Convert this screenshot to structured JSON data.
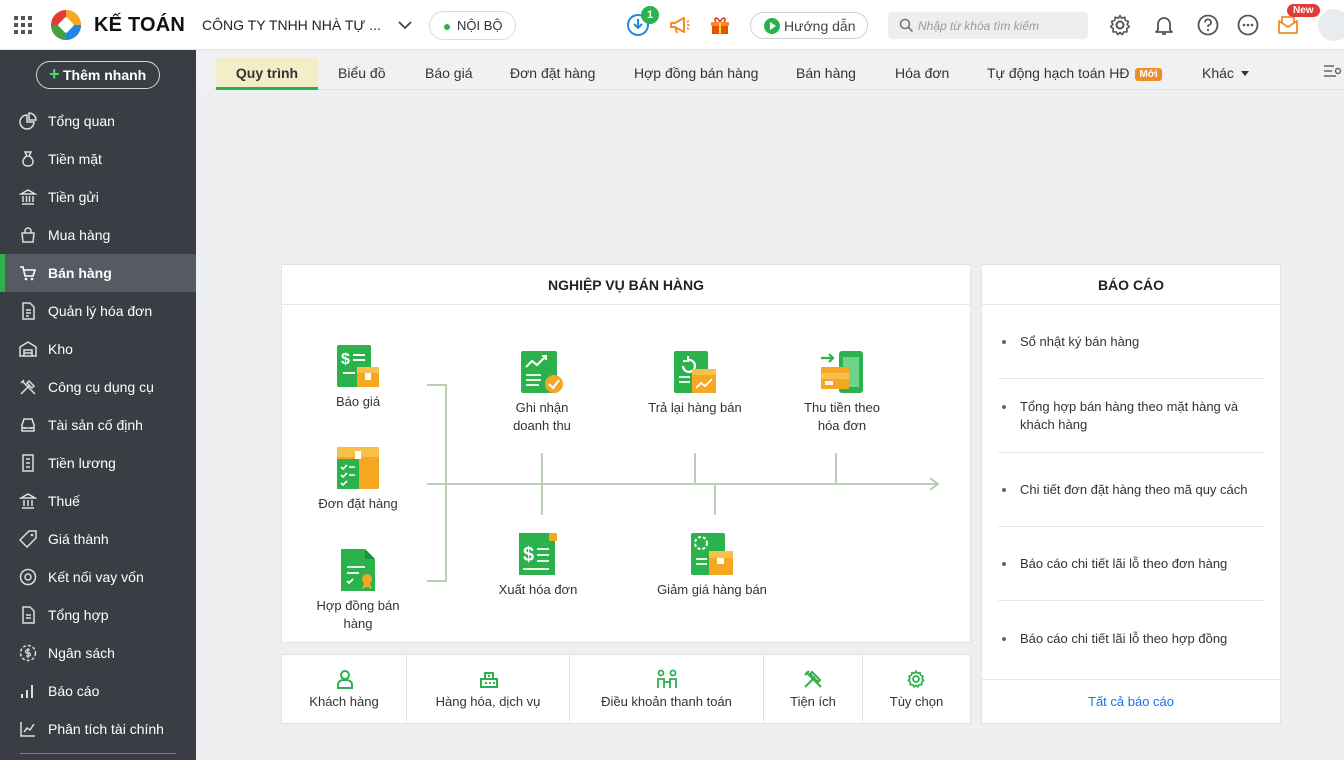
{
  "header": {
    "brand": "KẾ TOÁN",
    "company": "CÔNG TY TNHH NHÀ TỰ ...",
    "scope": "NỘI BỘ",
    "download_badge": "1",
    "guide_label": "Hướng dẫn",
    "search_placeholder": "Nhập từ khóa tìm kiếm",
    "new_badge": "New"
  },
  "sidebar": {
    "quick_add": "Thêm nhanh",
    "items": [
      {
        "label": "Tổng quan",
        "icon": "pie-chart-icon"
      },
      {
        "label": "Tiền mặt",
        "icon": "money-bag-icon"
      },
      {
        "label": "Tiền gửi",
        "icon": "bank-icon"
      },
      {
        "label": "Mua hàng",
        "icon": "shopping-bag-icon"
      },
      {
        "label": "Bán hàng",
        "icon": "cart-icon",
        "active": true
      },
      {
        "label": "Quản lý hóa đơn",
        "icon": "invoice-icon"
      },
      {
        "label": "Kho",
        "icon": "warehouse-icon"
      },
      {
        "label": "Công cụ dụng cụ",
        "icon": "tools-icon"
      },
      {
        "label": "Tài sản cố định",
        "icon": "car-icon"
      },
      {
        "label": "Tiền lương",
        "icon": "payroll-icon"
      },
      {
        "label": "Thuế",
        "icon": "tax-icon"
      },
      {
        "label": "Giá thành",
        "icon": "tag-icon"
      },
      {
        "label": "Kết nối vay vốn",
        "icon": "loan-icon"
      },
      {
        "label": "Tổng hợp",
        "icon": "summary-icon"
      },
      {
        "label": "Ngân sách",
        "icon": "budget-icon"
      },
      {
        "label": "Báo cáo",
        "icon": "bar-chart-icon"
      },
      {
        "label": "Phân tích tài chính",
        "icon": "analysis-icon"
      }
    ]
  },
  "tabs": [
    {
      "label": "Quy trình",
      "active": true
    },
    {
      "label": "Biểu đồ"
    },
    {
      "label": "Báo giá"
    },
    {
      "label": "Đơn đặt hàng"
    },
    {
      "label": "Hợp đồng bán hàng"
    },
    {
      "label": "Bán hàng"
    },
    {
      "label": "Hóa đơn"
    },
    {
      "label": "Tự động hạch toán HĐ",
      "badge": "Mới"
    },
    {
      "label": "Khác"
    }
  ],
  "process": {
    "title": "NGHIỆP VỤ BÁN HÀNG",
    "quote": "Báo giá",
    "order": "Đơn đặt hàng",
    "contract_line1": "Hợp đồng bán",
    "contract_line2": "hàng",
    "revenue_line1": "Ghi nhận",
    "revenue_line2": "doanh thu",
    "return": "Trả lại hàng bán",
    "collect_line1": "Thu tiền theo",
    "collect_line2": "hóa đơn",
    "issue_invoice": "Xuất hóa đơn",
    "discount": "Giảm giá hàng bán"
  },
  "reports": {
    "title": "BÁO CÁO",
    "items": [
      "Sổ nhật ký bán hàng",
      "Tổng hợp bán hàng theo mặt hàng và khách hàng",
      "Chi tiết đơn đặt hàng theo mã quy cách",
      "Báo cáo chi tiết lãi lỗ theo đơn hàng",
      "Báo cáo chi tiết lãi lỗ theo hợp đồng"
    ],
    "all": "Tất cả báo cáo"
  },
  "bottom": {
    "items": [
      "Khách hàng",
      "Hàng hóa, dịch vụ",
      "Điều khoản thanh toán",
      "Tiện ích",
      "Tùy chọn"
    ]
  },
  "colors": {
    "accent": "#2bb24c",
    "sidebar": "#3a3d44",
    "link": "#1a73e8",
    "new": "#e53935",
    "orange": "#f28c28"
  }
}
